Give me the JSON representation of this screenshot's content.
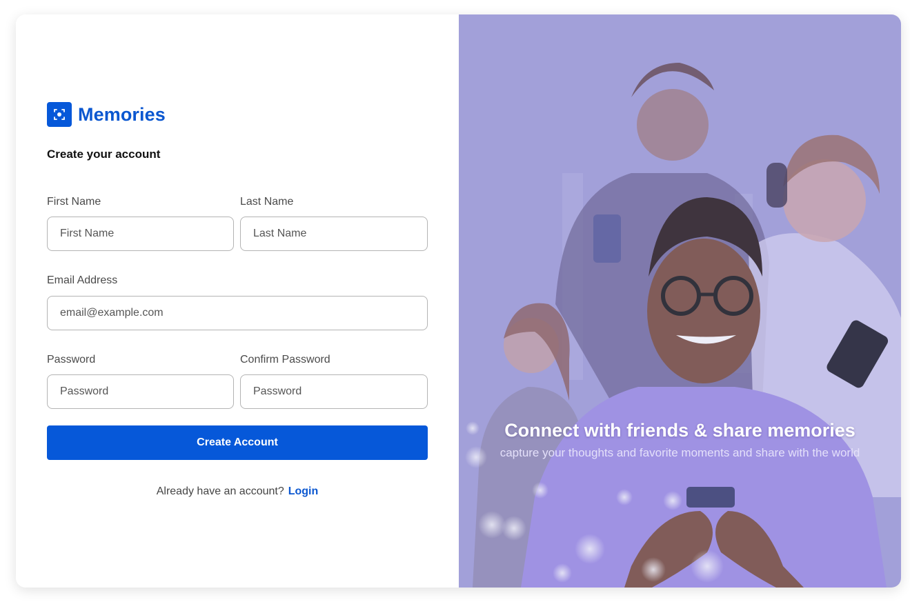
{
  "brand": {
    "name": "Memories",
    "logo_icon": "focus-camera-icon",
    "color": "#0b57d0"
  },
  "form": {
    "subtitle": "Create your account",
    "first_name": {
      "label": "First Name",
      "placeholder": "First Name",
      "value": ""
    },
    "last_name": {
      "label": "Last Name",
      "placeholder": "Last Name",
      "value": ""
    },
    "email": {
      "label": "Email Address",
      "placeholder": "email@example.com",
      "value": ""
    },
    "password": {
      "label": "Password",
      "placeholder": "Password",
      "value": ""
    },
    "confirm_password": {
      "label": "Confirm Password",
      "placeholder": "Password",
      "value": ""
    },
    "submit_label": "Create Account",
    "login_prompt": "Already have an account?",
    "login_link": "Login"
  },
  "hero": {
    "title": "Connect with friends & share memories",
    "subtitle": "capture your thoughts and favorite moments and share with the world",
    "overlay_color": "#a3a0d9"
  },
  "colors": {
    "primary": "#0658d9",
    "link": "#0b57d0"
  }
}
